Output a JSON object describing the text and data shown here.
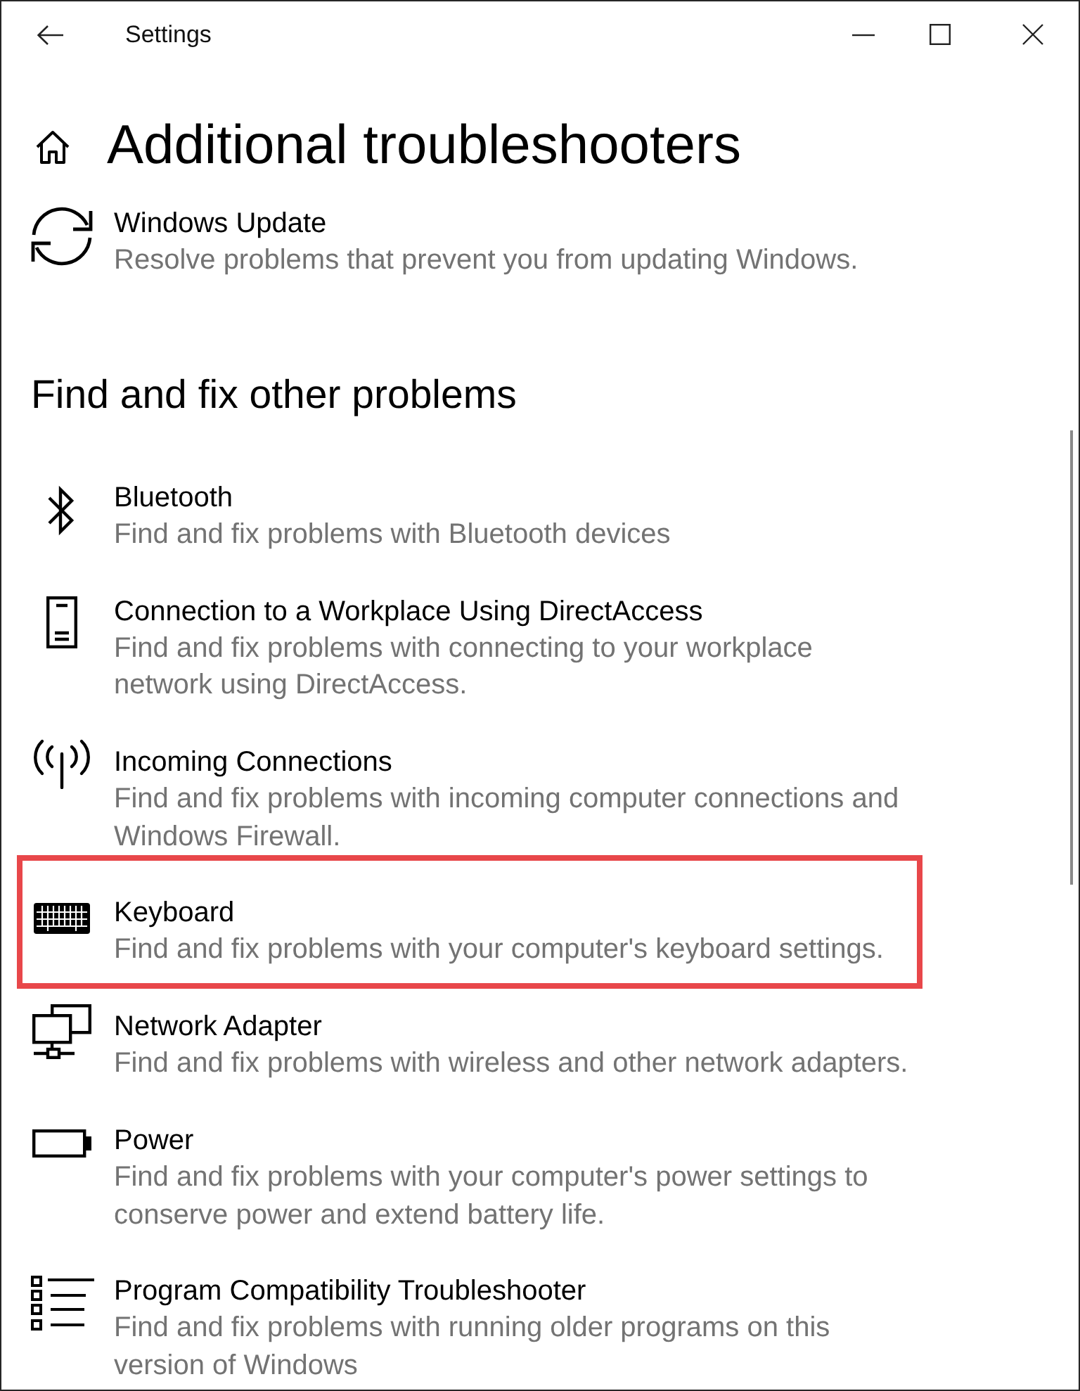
{
  "window": {
    "title": "Settings"
  },
  "page": {
    "title": "Additional troubleshooters"
  },
  "sections": [
    {
      "items": [
        {
          "kind": "update",
          "title": "Windows Update",
          "description": "Resolve problems that prevent you from updating Windows.",
          "highlighted": false
        }
      ]
    },
    {
      "heading": "Find and fix other problems",
      "items": [
        {
          "kind": "bluetooth",
          "title": "Bluetooth",
          "description": "Find and fix problems with Bluetooth devices",
          "highlighted": false
        },
        {
          "kind": "device",
          "title": "Connection to a Workplace Using DirectAccess",
          "description": "Find and fix problems with connecting to your workplace network using DirectAccess.",
          "highlighted": false
        },
        {
          "kind": "antenna",
          "title": "Incoming Connections",
          "description": "Find and fix problems with incoming computer connections and Windows Firewall.",
          "highlighted": false
        },
        {
          "kind": "keyboard",
          "title": "Keyboard",
          "description": "Find and fix problems with your computer's keyboard settings.",
          "highlighted": true
        },
        {
          "kind": "network",
          "title": "Network Adapter",
          "description": "Find and fix problems with wireless and other network adapters.",
          "highlighted": false
        },
        {
          "kind": "battery",
          "title": "Power",
          "description": "Find and fix problems with your computer's power settings to conserve power and extend battery life.",
          "highlighted": false
        },
        {
          "kind": "list",
          "title": "Program Compatibility Troubleshooter",
          "description": "Find and fix problems with running older programs on this version of Windows",
          "highlighted": false
        }
      ]
    }
  ]
}
